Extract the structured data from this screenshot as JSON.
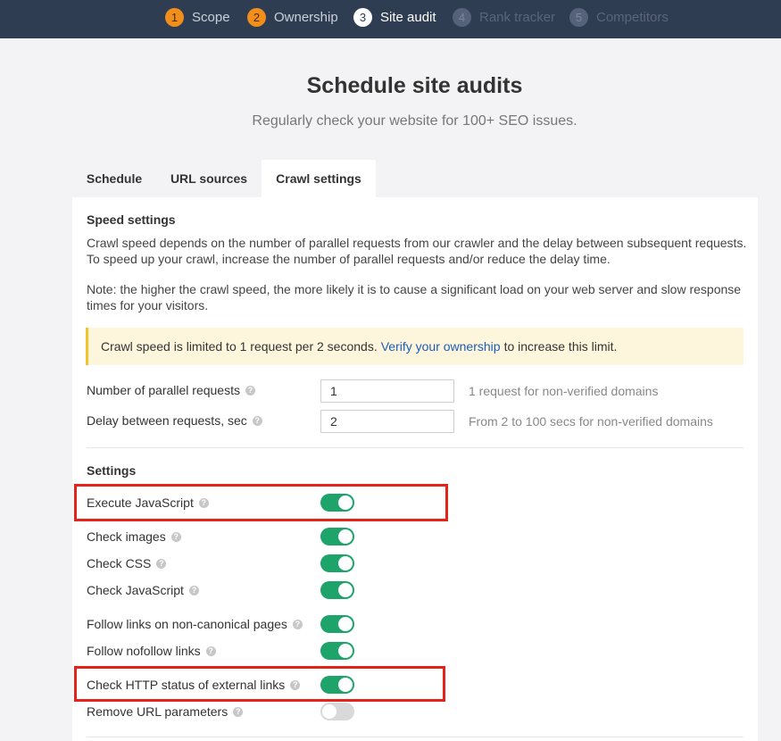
{
  "steps": [
    {
      "num": "1",
      "label": "Scope",
      "state": "done"
    },
    {
      "num": "2",
      "label": "Ownership",
      "state": "done"
    },
    {
      "num": "3",
      "label": "Site audit",
      "state": "active"
    },
    {
      "num": "4",
      "label": "Rank tracker",
      "state": "todo"
    },
    {
      "num": "5",
      "label": "Competitors",
      "state": "todo"
    }
  ],
  "header": {
    "title": "Schedule site audits",
    "subtitle": "Regularly check your website for 100+ SEO issues."
  },
  "tabs": [
    {
      "label": "Schedule"
    },
    {
      "label": "URL sources"
    },
    {
      "label": "Crawl settings",
      "selected": true
    }
  ],
  "speed": {
    "title": "Speed settings",
    "description": "Crawl speed depends on the number of parallel requests from our crawler and the delay between subsequent requests. To speed up your crawl, increase the number of parallel requests and/or reduce the delay time.",
    "note": "Note: the higher the crawl speed, the more likely it is to cause a significant load on your web server and slow response times for your visitors.",
    "notice": {
      "before": "Crawl speed is limited to 1 request per 2 seconds.",
      "link": "Verify your ownership",
      "after": "to increase this limit."
    },
    "fields": [
      {
        "label": "Number of parallel requests",
        "value": "1",
        "hint": "1 request for non-verified domains"
      },
      {
        "label": "Delay between requests, sec",
        "value": "2",
        "hint": "From 2 to 100 secs for non-verified domains"
      }
    ]
  },
  "settings": {
    "title": "Settings",
    "toggles": [
      {
        "label": "Execute JavaScript",
        "on": true
      },
      {
        "label": "Check images",
        "on": true
      },
      {
        "label": "Check CSS",
        "on": true
      },
      {
        "label": "Check JavaScript",
        "on": true
      },
      {
        "label": "Follow links on non-canonical pages",
        "on": true
      },
      {
        "label": "Follow nofollow links",
        "on": true
      },
      {
        "label": "Check HTTP status of external links",
        "on": true
      },
      {
        "label": "Remove URL parameters",
        "on": false
      }
    ]
  },
  "help_glyph": "?",
  "colors": {
    "topbar": "#2f3d52",
    "step_done": "#f28f1c",
    "toggle_on": "#1ea36b",
    "toggle_off": "#d9d9d9",
    "notice_bg": "#fdf6dd",
    "notice_border": "#f0c22b",
    "link": "#1a5eb8",
    "highlight": "#e3241b"
  }
}
